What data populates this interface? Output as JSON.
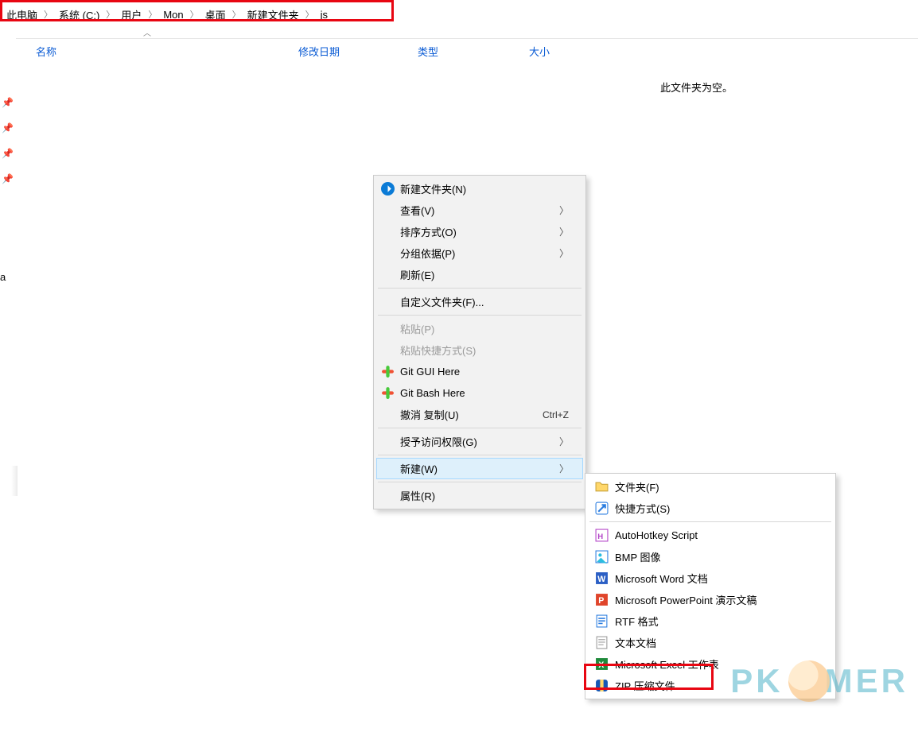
{
  "breadcrumb": {
    "parts": [
      "此电脑",
      "系统 (C:)",
      "用户",
      "Mon",
      "桌面",
      "新建文件夹",
      "js"
    ]
  },
  "columns": {
    "name": "名称",
    "modified": "修改日期",
    "type": "类型",
    "size": "大小"
  },
  "sort_indicator": "︿",
  "empty_folder": "此文件夹为空。",
  "truncated_left": "a",
  "context_menu": {
    "new_folder": "新建文件夹(N)",
    "view": "查看(V)",
    "sort": "排序方式(O)",
    "group": "分组依据(P)",
    "refresh": "刷新(E)",
    "customize": "自定义文件夹(F)...",
    "paste": "粘贴(P)",
    "paste_shortcut": "粘贴快捷方式(S)",
    "git_gui": "Git GUI Here",
    "git_bash": "Git Bash Here",
    "undo_copy": "撤消 复制(U)",
    "undo_short": "Ctrl+Z",
    "grant_access": "授予访问权限(G)",
    "new": "新建(W)",
    "properties": "属性(R)"
  },
  "new_submenu": {
    "folder": "文件夹(F)",
    "shortcut": "快捷方式(S)",
    "ahk": "AutoHotkey Script",
    "bmp": "BMP 图像",
    "word": "Microsoft Word 文档",
    "ppt": "Microsoft PowerPoint 演示文稿",
    "rtf": "RTF 格式",
    "txt": "文本文档",
    "xls": "Microsoft Excel 工作表",
    "zip": "ZIP 压缩文件"
  },
  "watermark": {
    "a": "PK",
    "b": "MER"
  }
}
